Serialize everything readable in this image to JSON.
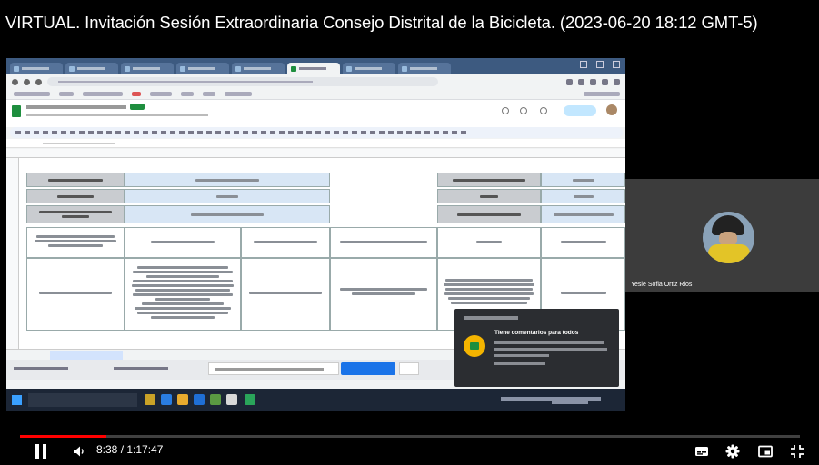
{
  "video": {
    "title": "VIRTUAL. Invitación Sesión Extraordinaria Consejo Distrital de la Bicicleta. (2023-06-20 18:12 GMT-5)"
  },
  "notification": {
    "title": "Tiene comentarios para todos"
  },
  "participant": {
    "name": "Yesie Sofia Ortiz Rios"
  },
  "player": {
    "time": "8:38 / 1:17:47",
    "progress_fraction": 0.111
  },
  "colors": {
    "progress": "#ff0000",
    "sheets_green": "#1e8e3e",
    "cell_blue": "#d8e6f5",
    "cell_grey": "#c9ccd0"
  },
  "icons": {
    "pause": "pause-icon",
    "volume": "volume-icon",
    "subtitles": "subtitles-icon",
    "settings": "gear-icon",
    "miniplayer": "miniplayer-icon",
    "fullscreen": "fullscreen-exit-icon"
  }
}
